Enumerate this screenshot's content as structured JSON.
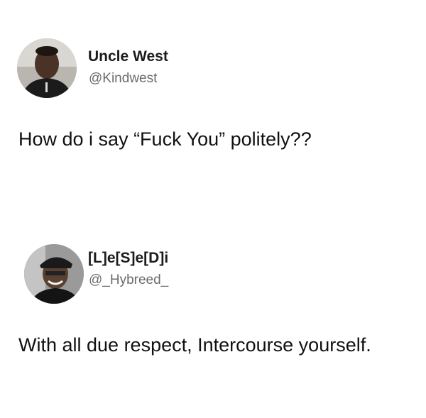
{
  "tweets": [
    {
      "display_name": "Uncle West",
      "handle": "@Kindwest",
      "text": "How do i say “Fuck You” politely??",
      "avatar_icon": "user-avatar-photo"
    },
    {
      "display_name": "[L]e[S]e[D]i",
      "handle": "@_Hybreed_",
      "text": "With all due respect, Intercourse yourself.",
      "avatar_icon": "user-avatar-photo"
    }
  ],
  "colors": {
    "background": "#ffffff",
    "name": "#1b1b1b",
    "handle": "#6b6b6b",
    "text": "#111111"
  }
}
